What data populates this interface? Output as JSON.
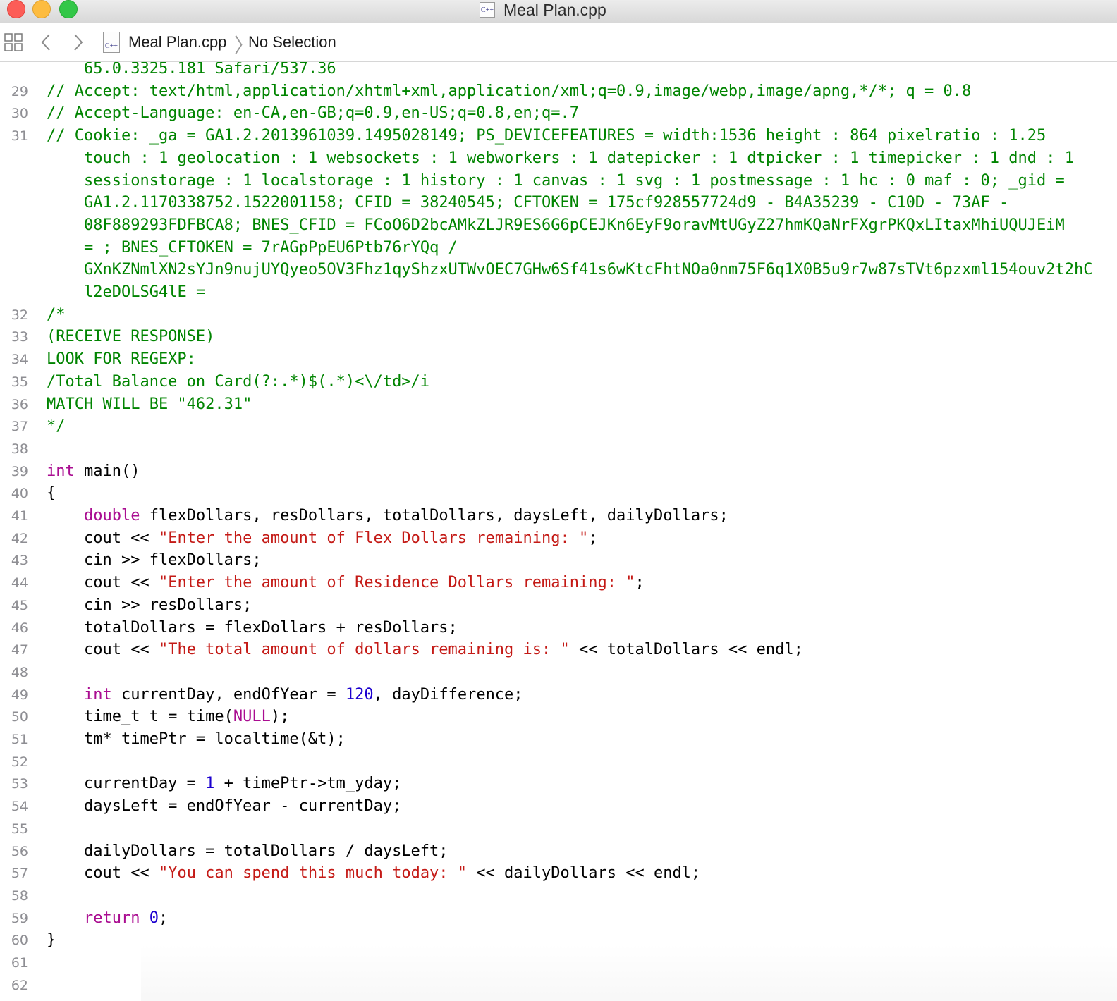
{
  "window": {
    "title": "Meal Plan.cpp",
    "file_badge": "C++"
  },
  "jumpbar": {
    "back_icon": "chevron-left-icon",
    "forward_icon": "chevron-right-icon",
    "file_name": "Meal Plan.cpp",
    "selection": "No Selection",
    "separator": "〉"
  },
  "colors": {
    "comment": "#008400",
    "keyword": "#aa0d91",
    "string": "#c41a16",
    "number": "#1c00cf"
  },
  "lines": [
    {
      "num": "",
      "cont": true,
      "text": "65.0.3325.181 Safari/537.36"
    },
    {
      "num": "29",
      "text": "// Accept: text/html,application/xhtml+xml,application/xml;q=0.9,image/webp,image/apng,*/*; q = 0.8"
    },
    {
      "num": "30",
      "text": "// Accept-Language: en-CA,en-GB;q=0.9,en-US;q=0.8,en;q=.7"
    },
    {
      "num": "31",
      "text": "// Cookie: _ga = GA1.2.2013961039.1495028149; PS_DEVICEFEATURES = width:1536 height : 864 pixelratio : 1.25"
    },
    {
      "num": "",
      "cont": true,
      "text": "touch : 1 geolocation : 1 websockets : 1 webworkers : 1 datepicker : 1 dtpicker : 1 timepicker : 1 dnd : 1"
    },
    {
      "num": "",
      "cont": true,
      "text": "sessionstorage : 1 localstorage : 1 history : 1 canvas : 1 svg : 1 postmessage : 1 hc : 0 maf : 0; _gid ="
    },
    {
      "num": "",
      "cont": true,
      "text": "GA1.2.1170338752.1522001158; CFID = 38240545; CFTOKEN = 175cf928557724d9 - B4A35239 - C10D - 73AF -"
    },
    {
      "num": "",
      "cont": true,
      "text": "08F889293FDFBCA8; BNES_CFID = FCoO6D2bcAMkZLJR9ES6G6pCEJKn6EyF9oravMtUGyZ27hmKQaNrFXgrPKQxLItaxMhiUQUJEiM"
    },
    {
      "num": "",
      "cont": true,
      "text": "= ; BNES_CFTOKEN = 7rAGpPpEU6Ptb76rYQq /"
    },
    {
      "num": "",
      "cont": true,
      "text": "GXnKZNmlXN2sYJn9nujUYQyeo5OV3Fhz1qyShzxUTWvOEC7GHw6Sf41s6wKtcFhtNOa0nm75F6q1X0B5u9r7w87sTVt6pzxml154ouv2t2hC"
    },
    {
      "num": "",
      "cont": true,
      "text": "l2eDOLSG4lE ="
    },
    {
      "num": "32",
      "text": "/*"
    },
    {
      "num": "33",
      "text": "(RECEIVE RESPONSE)"
    },
    {
      "num": "34",
      "text": "LOOK FOR REGEXP:"
    },
    {
      "num": "35",
      "text": "/Total Balance on Card(?:.*)$(.*)<\\/td>/i"
    },
    {
      "num": "36",
      "text": "MATCH WILL BE \"462.31\""
    },
    {
      "num": "37",
      "text": "*/"
    },
    {
      "num": "38",
      "text": ""
    },
    {
      "num": "39",
      "text": "int main()"
    },
    {
      "num": "40",
      "text": "{"
    },
    {
      "num": "41",
      "text": "    double flexDollars, resDollars, totalDollars, daysLeft, dailyDollars;"
    },
    {
      "num": "42",
      "text": "    cout << \"Enter the amount of Flex Dollars remaining: \";"
    },
    {
      "num": "43",
      "text": "    cin >> flexDollars;"
    },
    {
      "num": "44",
      "text": "    cout << \"Enter the amount of Residence Dollars remaining: \";"
    },
    {
      "num": "45",
      "text": "    cin >> resDollars;"
    },
    {
      "num": "46",
      "text": "    totalDollars = flexDollars + resDollars;"
    },
    {
      "num": "47",
      "text": "    cout << \"The total amount of dollars remaining is: \" << totalDollars << endl;"
    },
    {
      "num": "48",
      "text": ""
    },
    {
      "num": "49",
      "text": "    int currentDay, endOfYear = 120, dayDifference;"
    },
    {
      "num": "50",
      "text": "    time_t t = time(NULL);"
    },
    {
      "num": "51",
      "text": "    tm* timePtr = localtime(&t);"
    },
    {
      "num": "52",
      "text": ""
    },
    {
      "num": "53",
      "text": "    currentDay = 1 + timePtr->tm_yday;"
    },
    {
      "num": "54",
      "text": "    daysLeft = endOfYear - currentDay;"
    },
    {
      "num": "55",
      "text": ""
    },
    {
      "num": "56",
      "text": "    dailyDollars = totalDollars / daysLeft;"
    },
    {
      "num": "57",
      "text": "    cout << \"You can spend this much today: \" << dailyDollars << endl;"
    },
    {
      "num": "58",
      "text": ""
    },
    {
      "num": "59",
      "text": "    return 0;"
    },
    {
      "num": "60",
      "text": "}"
    },
    {
      "num": "61",
      "text": ""
    },
    {
      "num": "62",
      "text": ""
    }
  ]
}
